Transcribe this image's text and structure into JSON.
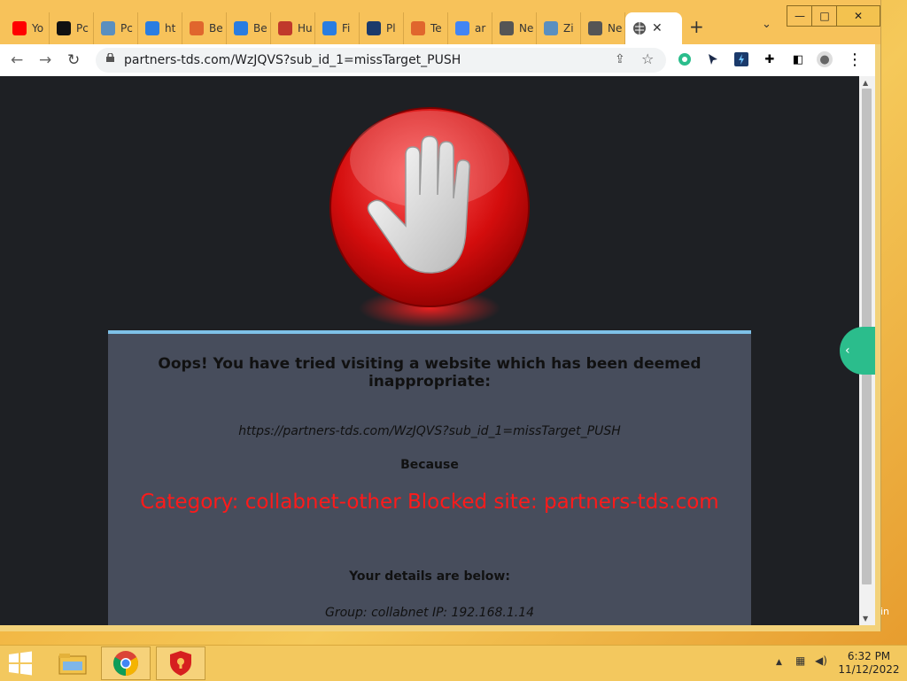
{
  "browser": {
    "tabs": [
      {
        "label": "Yo",
        "icon": "youtube-icon",
        "color": "#ff0000"
      },
      {
        "label": "Pc",
        "icon": "brand-icon",
        "color": "#111111"
      },
      {
        "label": "Pc",
        "icon": "hex-icon",
        "color": "#5a8fbf"
      },
      {
        "label": "ht",
        "icon": "bolt-icon",
        "color": "#2a7de1"
      },
      {
        "label": "Be",
        "icon": "rainbow-icon",
        "color": "#e0662d"
      },
      {
        "label": "Be",
        "icon": "bolt-icon",
        "color": "#2a7de1"
      },
      {
        "label": "Hu",
        "icon": "v-icon",
        "color": "#c0392b"
      },
      {
        "label": "Fi",
        "icon": "plane-icon",
        "color": "#2a7de1"
      },
      {
        "label": "Pl",
        "icon": "v-icon",
        "color": "#1b3a6b"
      },
      {
        "label": "Te",
        "icon": "mail-icon",
        "color": "#e0662d"
      },
      {
        "label": "ar",
        "icon": "google-icon",
        "color": "#4285f4"
      },
      {
        "label": "Ne",
        "icon": "chrome-icon",
        "color": "#555555"
      },
      {
        "label": "Zi",
        "icon": "hex-icon",
        "color": "#5a8fbf"
      },
      {
        "label": "Ne",
        "icon": "chrome-icon",
        "color": "#555555"
      }
    ],
    "active_tab": {
      "icon": "globe-icon",
      "close": "✕"
    },
    "new_tab": "+",
    "tab_search": "⌄",
    "window_controls": {
      "minimize": "—",
      "maximize": "□",
      "close": "✕"
    },
    "nav": {
      "back": "←",
      "forward": "→",
      "reload": "↻"
    },
    "url": "partners-tds.com/WzJQVS?sub_id_1=missTarget_PUSH",
    "icons": {
      "share": "⇪",
      "star": "☆",
      "puzzle": "✚",
      "panel": "◧",
      "profile": "●",
      "menu": "⋮"
    }
  },
  "page": {
    "heading": "Oops! You have tried visiting a website which has been deemed inappropriate:",
    "blocked_url": "https://partners-tds.com/WzJQVS?sub_id_1=missTarget_PUSH",
    "because": "Because",
    "category": "Category: collabnet-other  Blocked site: partners-tds.com",
    "details_heading": "Your details are below:",
    "group_line": "Group: collabnet   IP: 192.168.1.14",
    "side_tab": "‹",
    "corner_text": "in"
  },
  "taskbar": {
    "time": "6:32 PM",
    "date": "11/12/2022",
    "tray": {
      "arrow": "▲",
      "network": "▦",
      "volume": "◀)"
    }
  }
}
